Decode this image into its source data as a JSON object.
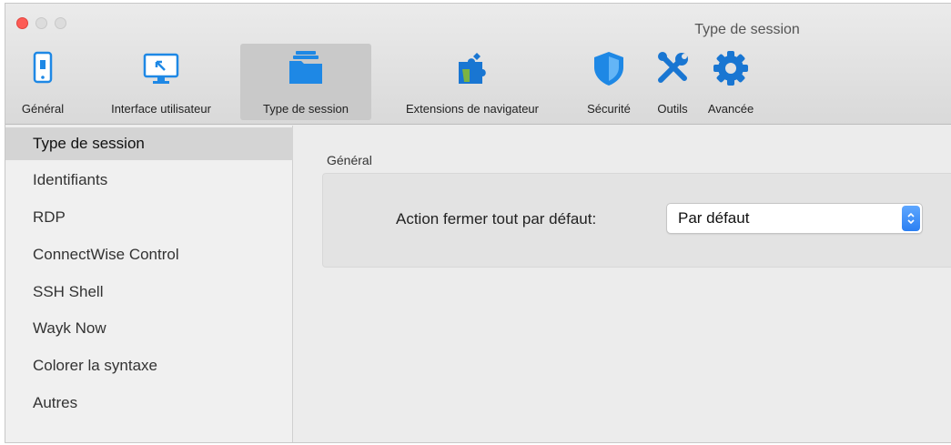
{
  "window": {
    "title": "Type de session"
  },
  "toolbar": {
    "items": [
      {
        "label": "Général",
        "icon": "phone-icon",
        "selected": false
      },
      {
        "label": "Interface utilisateur",
        "icon": "monitor-icon",
        "selected": false
      },
      {
        "label": "Type de session",
        "icon": "folder-icon",
        "selected": true
      },
      {
        "label": "Extensions de navigateur",
        "icon": "puzzle-icon",
        "selected": false
      },
      {
        "label": "Sécurité",
        "icon": "shield-icon",
        "selected": false
      },
      {
        "label": "Outils",
        "icon": "tools-icon",
        "selected": false
      },
      {
        "label": "Avancée",
        "icon": "gear-icon",
        "selected": false
      }
    ]
  },
  "sidebar": {
    "items": [
      {
        "label": "Type de session",
        "active": true
      },
      {
        "label": "Identifiants",
        "active": false
      },
      {
        "label": "RDP",
        "active": false
      },
      {
        "label": "ConnectWise Control",
        "active": false
      },
      {
        "label": "SSH Shell",
        "active": false
      },
      {
        "label": "Wayk Now",
        "active": false
      },
      {
        "label": "Colorer la syntaxe",
        "active": false
      },
      {
        "label": "Autres",
        "active": false
      }
    ]
  },
  "main": {
    "section_title": "Général",
    "close_all_action": {
      "label": "Action fermer tout par défaut:",
      "value": "Par défaut"
    }
  },
  "colors": {
    "accent": "#2b7ff2",
    "icon_blue": "#1e88e5",
    "icon_teal": "#1976d2"
  }
}
